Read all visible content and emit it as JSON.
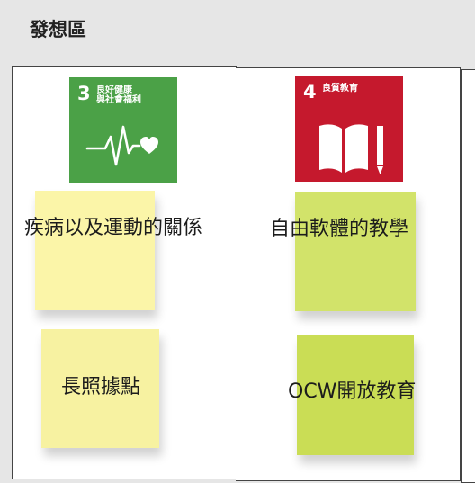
{
  "page": {
    "title": "發想區"
  },
  "columns": [
    {
      "sdg": {
        "number": "3",
        "label_lines": [
          "良好健康",
          "與社會福利"
        ],
        "color": "#4ba147",
        "icon": "heartbeat-icon"
      },
      "notes": [
        {
          "text": "疾病以及運動的關係",
          "color": "#fbf5a8"
        },
        {
          "text": "長照據點",
          "color": "#f7f2a1"
        }
      ]
    },
    {
      "sdg": {
        "number": "4",
        "label_lines": [
          "良質教育"
        ],
        "color": "#c5192d",
        "icon": "book-pencil-icon"
      },
      "notes": [
        {
          "text": "自由軟體的教學",
          "color": "#d2e36a"
        },
        {
          "text": "OCW開放教育",
          "color": "#cadd55"
        }
      ]
    }
  ]
}
